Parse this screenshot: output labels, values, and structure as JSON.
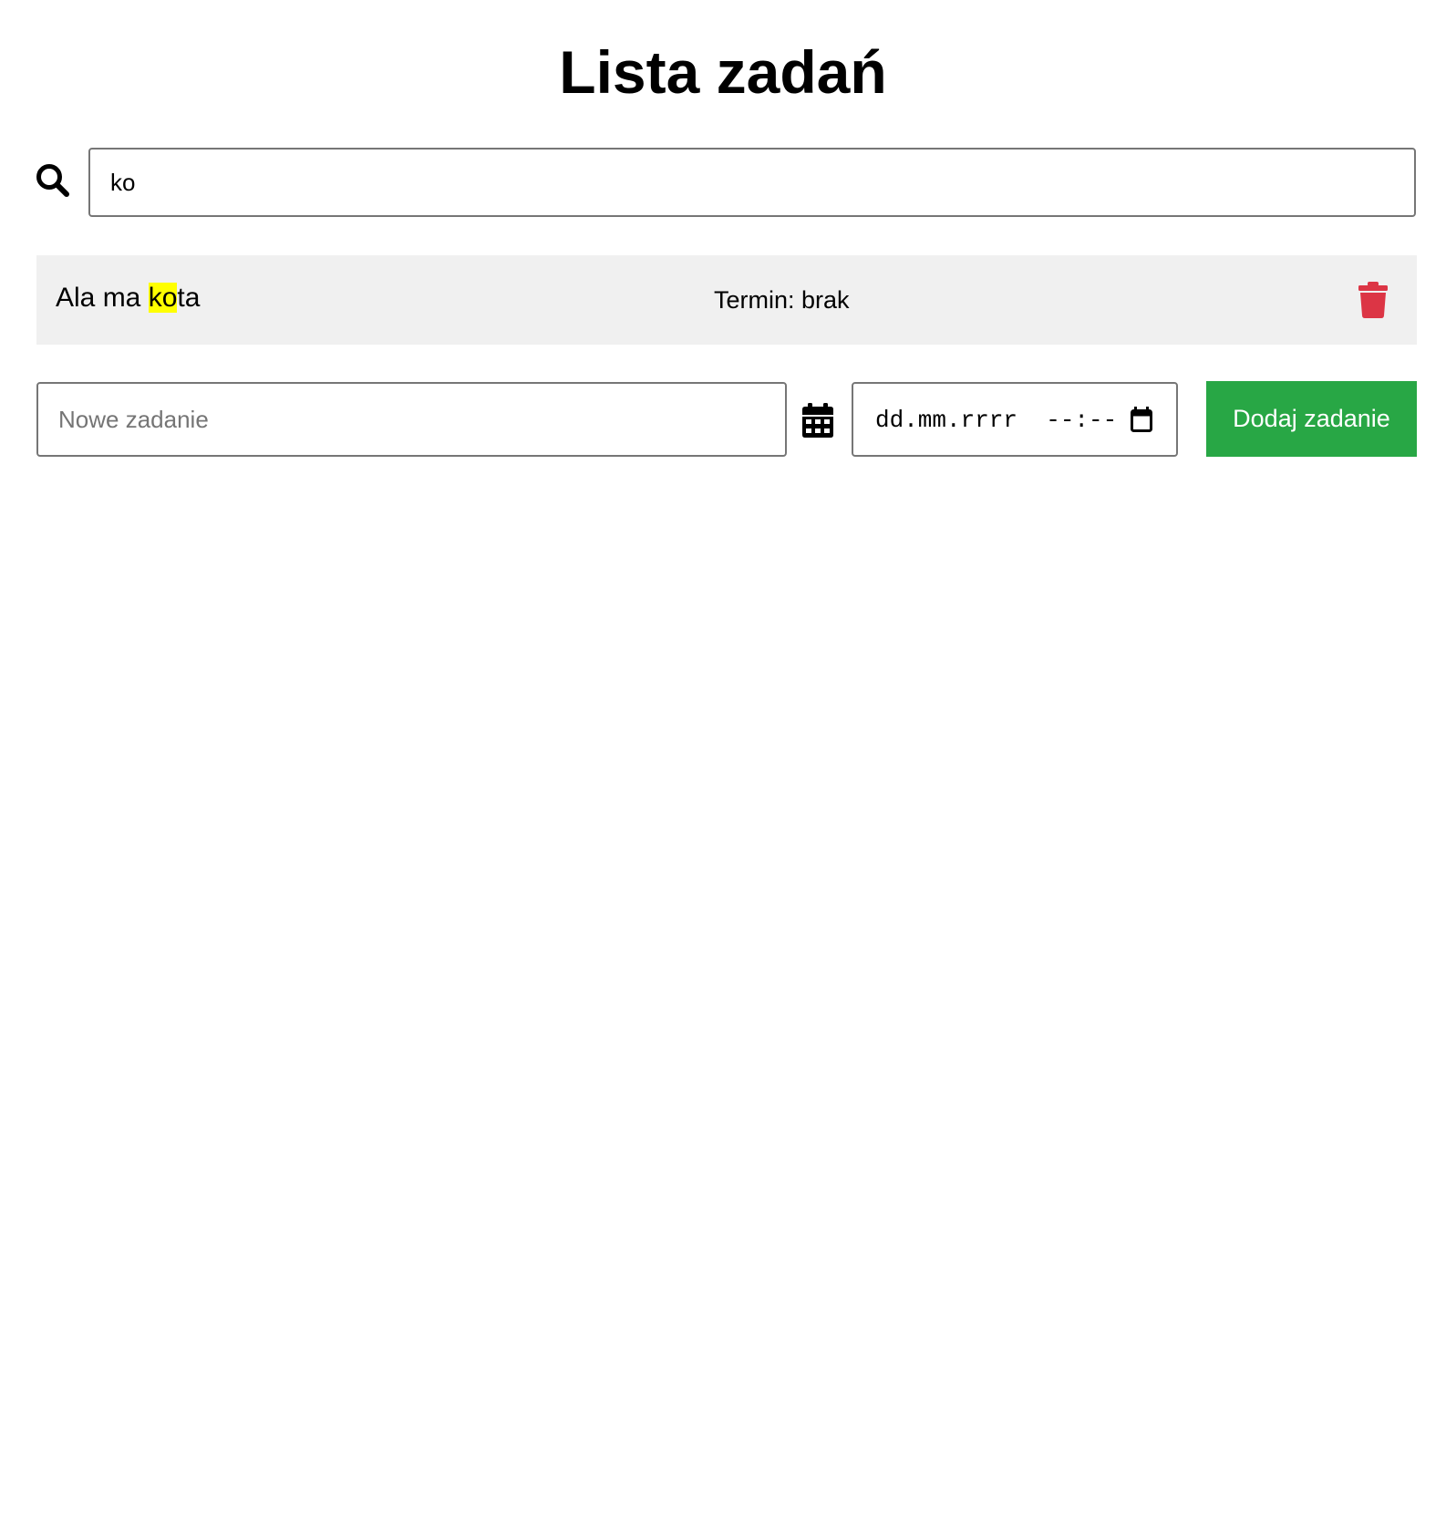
{
  "header": {
    "title": "Lista zadań"
  },
  "search": {
    "value": "ko",
    "icon": "search-icon"
  },
  "tasks": [
    {
      "text_before": "Ala ma ",
      "text_match": "ko",
      "text_after": "ta",
      "deadline": "Termin: brak",
      "delete_icon": "trash-icon"
    }
  ],
  "new_task": {
    "placeholder": "Nowe zadanie",
    "value": "",
    "calendar_icon": "calendar-icon",
    "datetime_display": "dd.mm.rrrr  --:--",
    "datetime_picker_icon": "calendar-picker-icon",
    "add_button_label": "Dodaj zadanie"
  },
  "colors": {
    "add_button": "#28a745",
    "delete_icon": "#dc3545",
    "highlight": "#ffff00",
    "task_background": "#f0f0f0"
  }
}
